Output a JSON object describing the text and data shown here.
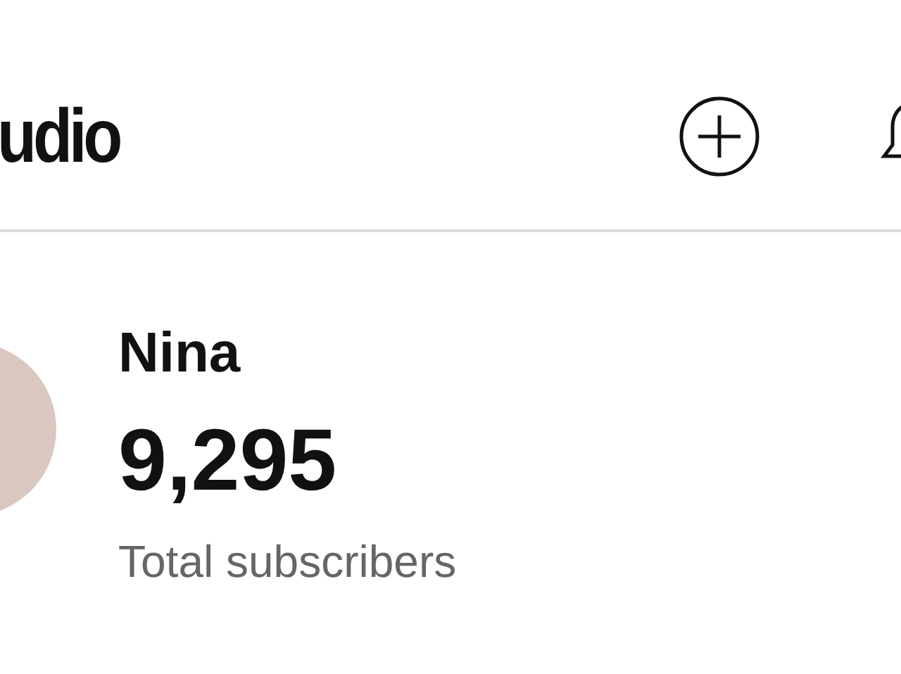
{
  "header": {
    "logo_text": "udio"
  },
  "channel": {
    "name": "Nina",
    "subscriber_count": "9,295",
    "subscriber_label": "Total subscribers"
  }
}
